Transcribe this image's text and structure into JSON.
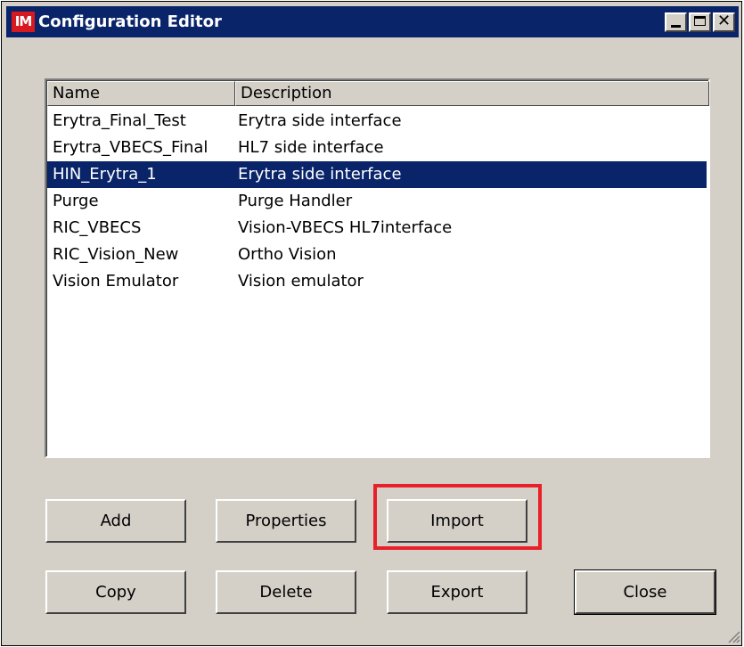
{
  "window": {
    "title": "Configuration Editor",
    "app_icon_text": "IM",
    "app_icon_color": "#d71920",
    "title_bar_color": "#0a246a",
    "controls": {
      "minimize_icon": "minimize-icon",
      "maximize_icon": "maximize-icon",
      "close_glyph": "✕"
    }
  },
  "list": {
    "columns": [
      "Name",
      "Description"
    ],
    "rows": [
      {
        "name": "Erytra_Final_Test",
        "description": "Erytra side interface",
        "selected": false
      },
      {
        "name": "Erytra_VBECS_Final",
        "description": "HL7 side interface",
        "selected": false
      },
      {
        "name": "HIN_Erytra_1",
        "description": "Erytra side interface",
        "selected": true
      },
      {
        "name": "Purge",
        "description": "Purge Handler",
        "selected": false
      },
      {
        "name": "RIC_VBECS",
        "description": "Vision-VBECS HL7interface",
        "selected": false
      },
      {
        "name": "RIC_Vision_New",
        "description": "Ortho Vision",
        "selected": false
      },
      {
        "name": "Vision Emulator",
        "description": "Vision emulator",
        "selected": false
      }
    ],
    "selection_color": "#0a246a"
  },
  "buttons": {
    "add": "Add",
    "properties": "Properties",
    "import": "Import",
    "copy": "Copy",
    "delete": "Delete",
    "export": "Export",
    "close": "Close"
  },
  "annotation": {
    "highlight_color": "#e8202a",
    "target": "Import"
  }
}
